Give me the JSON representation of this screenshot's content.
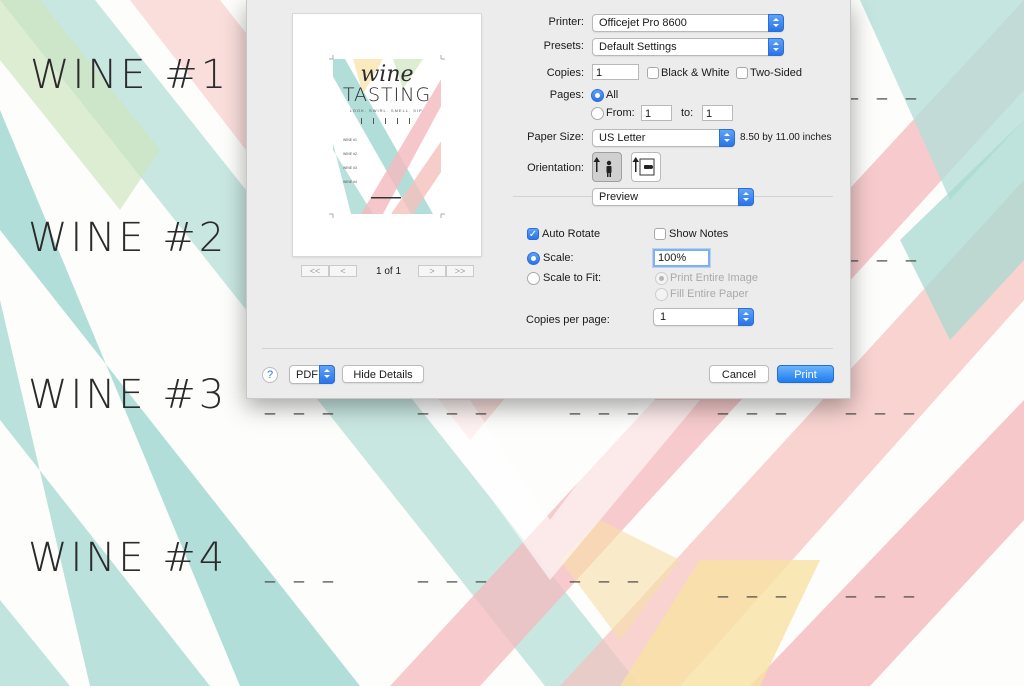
{
  "background": {
    "wine_labels": [
      "WINE #1",
      "WINE #2",
      "WINE #3",
      "WINE #4"
    ],
    "dash": "_ _ _"
  },
  "dialog": {
    "printer_label": "Printer:",
    "printer_value": "Officejet Pro 8600",
    "presets_label": "Presets:",
    "presets_value": "Default Settings",
    "copies_label": "Copies:",
    "copies_value": "1",
    "black_white_label": "Black & White",
    "two_sided_label": "Two-Sided",
    "pages_label": "Pages:",
    "pages_all_label": "All",
    "pages_from_label": "From:",
    "pages_from_value": "1",
    "pages_to_label": "to:",
    "pages_to_value": "1",
    "paper_size_label": "Paper Size:",
    "paper_size_value": "US Letter",
    "paper_size_dims": "8.50 by 11.00 inches",
    "orientation_label": "Orientation:",
    "section_value": "Preview",
    "auto_rotate_label": "Auto Rotate",
    "show_notes_label": "Show Notes",
    "scale_label": "Scale:",
    "scale_value": "100%",
    "scale_to_fit_label": "Scale to Fit:",
    "print_entire_image_label": "Print Entire Image",
    "fill_entire_paper_label": "Fill Entire Paper",
    "copies_per_page_label": "Copies per page:",
    "copies_per_page_value": "1",
    "help_label": "?",
    "pdf_label": "PDF",
    "hide_details_label": "Hide Details",
    "cancel_label": "Cancel",
    "print_label": "Print"
  },
  "preview": {
    "page_indicator": "1 of 1",
    "first_label": "<<",
    "prev_label": "<",
    "next_label": ">",
    "last_label": ">>",
    "wine_text": "wine",
    "tasting_text": "TASTING",
    "subtitle": "LOOK. SWIRL. SMELL. SIP.",
    "lines": [
      "WINE #1",
      "WINE #2",
      "WINE #3",
      "WINE #4"
    ]
  },
  "colors": {
    "accent": "#2a74ea",
    "mint": "#9fd6cf",
    "pink": "#f4b9bd",
    "yellow": "#f7e2a3"
  }
}
